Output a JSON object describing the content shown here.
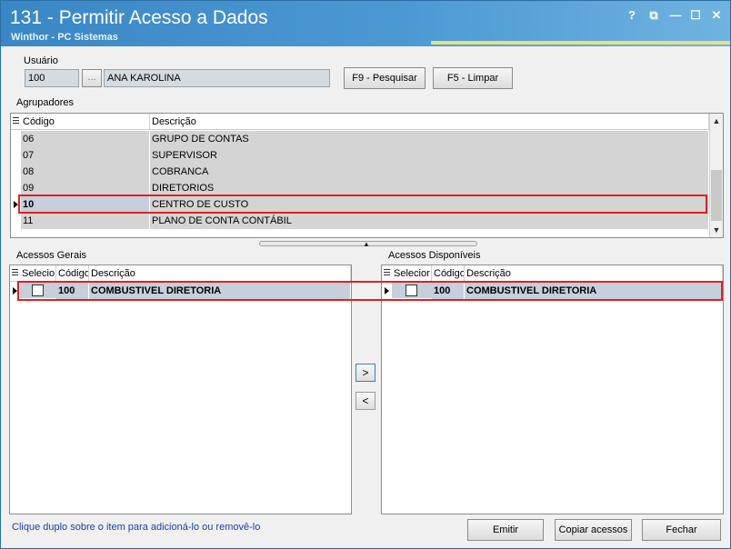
{
  "window": {
    "title": "131 - Permitir Acesso a Dados",
    "subtitle": "Winthor - PC Sistemas",
    "controls": {
      "help": "?",
      "restore": "⧉",
      "minimize": "—",
      "maximize": "☐",
      "close": "✕"
    }
  },
  "usuario": {
    "label": "Usuário",
    "code": "100",
    "lookup": "...",
    "name": "ANA KAROLINA",
    "search_button": "F9 - Pesquisar",
    "clear_button": "F5 - Limpar"
  },
  "agrupadores": {
    "label": "Agrupadores",
    "columns": [
      "Código",
      "Descrição"
    ],
    "rows": [
      {
        "code": "06",
        "desc": "GRUPO DE CONTAS"
      },
      {
        "code": "07",
        "desc": "SUPERVISOR"
      },
      {
        "code": "08",
        "desc": "COBRANCA"
      },
      {
        "code": "09",
        "desc": "DIRETORIOS"
      },
      {
        "code": "10",
        "desc": "CENTRO DE CUSTO"
      },
      {
        "code": "11",
        "desc": "PLANO DE CONTA CONTÁBIL"
      }
    ],
    "selected_index": 4
  },
  "acessos_gerais": {
    "label": "Acessos Gerais",
    "columns": [
      "Selecio",
      "Código",
      "Descrição"
    ],
    "rows": [
      {
        "code": "100",
        "desc": "COMBUSTIVEL DIRETORIA"
      }
    ]
  },
  "acessos_disponiveis": {
    "label": "Acessos Disponíveis",
    "columns": [
      "Selecior",
      "Código",
      "Descrição"
    ],
    "rows": [
      {
        "code": "100",
        "desc": "COMBUSTIVEL DIRETORIA"
      }
    ]
  },
  "move": {
    "right": ">",
    "left": "<"
  },
  "footer": {
    "hint": "Clique duplo sobre o item para adicioná-lo ou removê-lo",
    "emitir": "Emitir",
    "copiar": "Copiar acessos",
    "fechar": "Fechar"
  },
  "colors": {
    "accent": "#3a87c5",
    "highlight": "#e02020",
    "row_bg": "#d4d4d4",
    "selected_row_bg": "#c7cfdc"
  }
}
